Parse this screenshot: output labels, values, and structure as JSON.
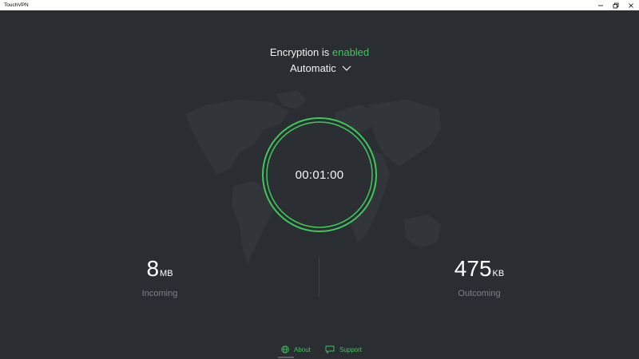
{
  "window": {
    "title": "TouchVPN",
    "controls": {
      "minimize": "minimize-icon",
      "maximize": "restore-icon",
      "close": "close-icon"
    }
  },
  "encryption": {
    "prefix": "Encryption is",
    "status": "enabled",
    "status_color": "#3ec85a"
  },
  "location": {
    "selected": "Automatic",
    "icon": "chevron-down-icon"
  },
  "timer": {
    "elapsed": "00:01:00",
    "ring_color": "#3ec85a"
  },
  "stats": {
    "incoming": {
      "value": "8",
      "unit": "MB",
      "label": "Incoming"
    },
    "outgoing": {
      "value": "475",
      "unit": "KB",
      "label": "Outcoming"
    }
  },
  "footer": {
    "about": {
      "label": "About",
      "icon": "globe-icon"
    },
    "support": {
      "label": "Support",
      "icon": "chat-bubble-icon"
    }
  },
  "colors": {
    "background": "#2a2d32",
    "map": "#33363b",
    "accent": "#3ec85a",
    "muted_text": "#7c8087"
  }
}
